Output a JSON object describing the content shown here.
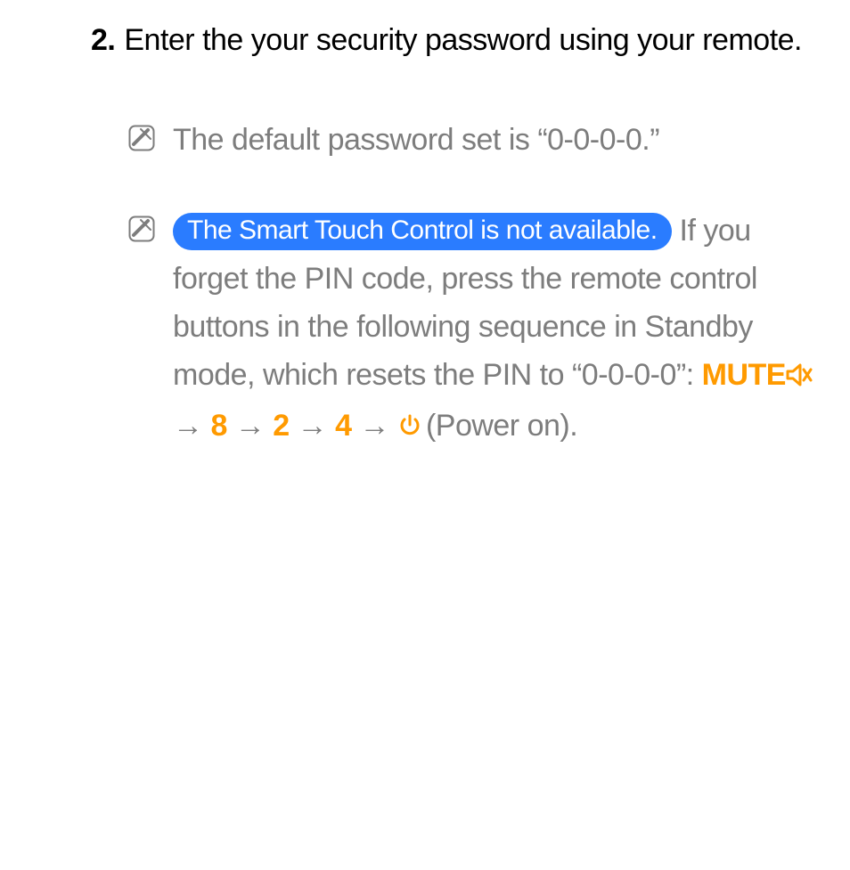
{
  "step": {
    "number": "2.",
    "text": "Enter the your security password using your remote."
  },
  "notes": [
    {
      "text": "The default password set is “0-0-0-0.”"
    },
    {
      "badge": "The Smart Touch Control is not available.",
      "text_before_seq": "If you forget the PIN code, press the remote control buttons in the following sequence in Standby mode, which resets the PIN to “0-0-0-0”: ",
      "sequence": {
        "mute_label": "MUTE",
        "n1": "8",
        "n2": "2",
        "n3": "4",
        "power_label": "(Power on)."
      }
    }
  ],
  "arrows": " → ",
  "colors": {
    "accent": "#ff9a00",
    "badge": "#2a7cff",
    "body": "#7d7d7d"
  }
}
